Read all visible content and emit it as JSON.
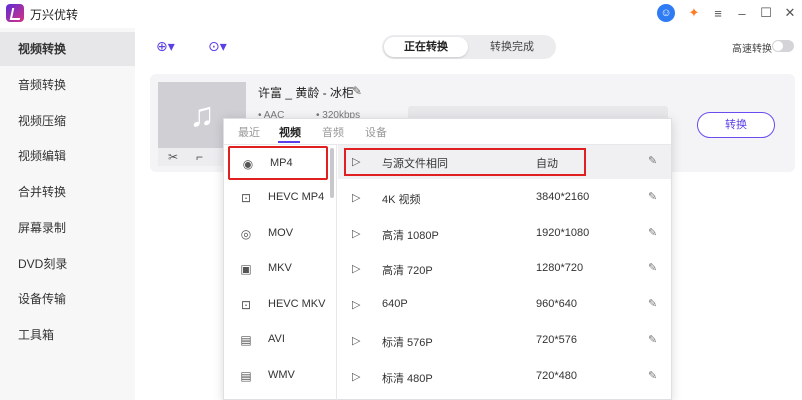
{
  "app": {
    "title": "万兴优转"
  },
  "sidebar": {
    "items": [
      {
        "label": "视频转换",
        "active": true
      },
      {
        "label": "音频转换"
      },
      {
        "label": "视频压缩"
      },
      {
        "label": "视频编辑"
      },
      {
        "label": "合并转换"
      },
      {
        "label": "屏幕录制"
      },
      {
        "label": "DVD刻录"
      },
      {
        "label": "设备传输"
      },
      {
        "label": "工具箱"
      }
    ]
  },
  "toolbar": {
    "tab_converting": "正在转换",
    "tab_done": "转换完成",
    "fast_label": "高速转换"
  },
  "file": {
    "title": "许富 _ 黄龄 - 冰柜",
    "audio": "• AAC",
    "bitrate": "• 320kbps",
    "convert": "转换"
  },
  "dropdown": {
    "tabs": [
      "最近",
      "视频",
      "音频",
      "设备"
    ],
    "formats": [
      {
        "label": "MP4",
        "icon": "◉"
      },
      {
        "label": "HEVC MP4",
        "icon": "⊡"
      },
      {
        "label": "MOV",
        "icon": "◎"
      },
      {
        "label": "MKV",
        "icon": "▣"
      },
      {
        "label": "HEVC MKV",
        "icon": "⊡"
      },
      {
        "label": "AVI",
        "icon": "▤"
      },
      {
        "label": "WMV",
        "icon": "▤"
      }
    ],
    "resolutions": [
      {
        "name": "与源文件相同",
        "value": "自动"
      },
      {
        "name": "4K 视频",
        "value": "3840*2160"
      },
      {
        "name": "高清 1080P",
        "value": "1920*1080"
      },
      {
        "name": "高清 720P",
        "value": "1280*720"
      },
      {
        "name": "640P",
        "value": "960*640"
      },
      {
        "name": "标清 576P",
        "value": "720*576"
      },
      {
        "name": "标清 480P",
        "value": "720*480"
      }
    ]
  }
}
